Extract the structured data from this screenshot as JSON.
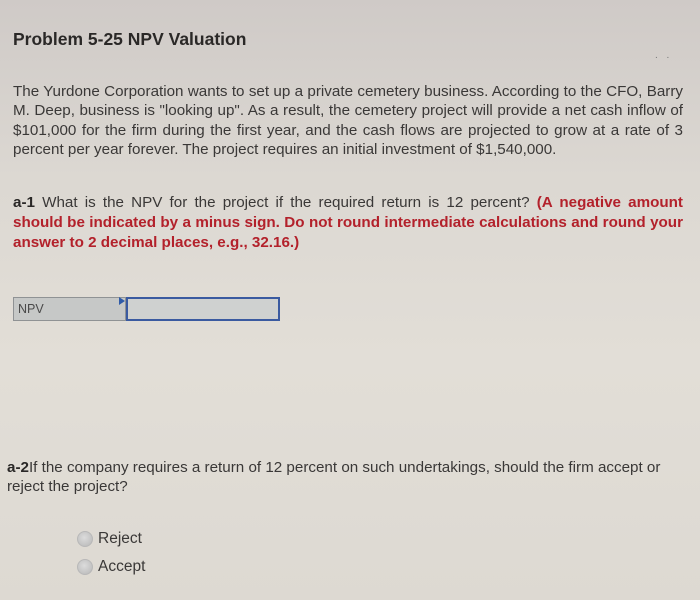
{
  "problem": {
    "title": "Problem 5-25 NPV Valuation",
    "more_indicator": ". .",
    "intro": "The Yurdone Corporation wants to set up a private cemetery business. According to the CFO, Barry M. Deep, business is \"looking up\". As a result, the cemetery project will provide a net cash inflow of $101,000 for the firm during the first year, and the cash flows are projected to grow at a rate of 3 percent per year forever. The project requires an initial investment of $1,540,000."
  },
  "question_a1": {
    "label": "a-1",
    "text": " What is the NPV for the project if the required return is 12 percent? ",
    "instruction": "(A negative amount should be indicated by a minus sign. Do not round intermediate calculations and round your answer to 2 decimal places, e.g., 32.16.)",
    "answer_label": "NPV",
    "answer_value": ""
  },
  "question_a2": {
    "label": "a-2",
    "text": "If the company requires a return of 12 percent on such undertakings, should the firm accept or reject the project?",
    "options": [
      {
        "label": "Reject",
        "selected": false
      },
      {
        "label": "Accept",
        "selected": false
      }
    ]
  }
}
